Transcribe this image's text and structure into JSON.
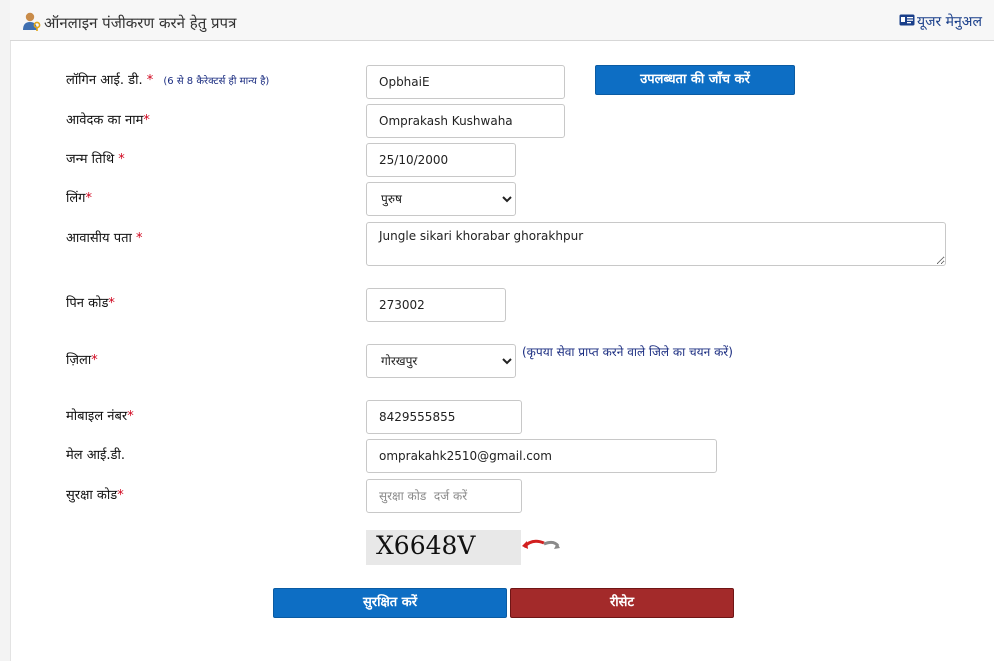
{
  "header": {
    "title": "ऑनलाइन पंजीकरण करने हेतु प्रपत्र",
    "title_icon": "user-key-icon",
    "user_manual": "यूजर मेनुअल",
    "user_manual_icon": "id-card-icon"
  },
  "form": {
    "login_id": {
      "label": "लॉगिन आई. डी.",
      "required": "*",
      "note": "(6 से 8 कैरेक्टर्स ही मान्य है)",
      "value": "OpbhaiE"
    },
    "check_button": "उपलब्धता की जाँच करें",
    "applicant_name": {
      "label": "आवेदक का नाम",
      "required": "*",
      "value": "Omprakash Kushwaha"
    },
    "dob": {
      "label": "जन्म तिथि",
      "required": "*",
      "value": "25/10/2000"
    },
    "gender": {
      "label": "लिंग",
      "required": "*",
      "value": "पुरुष"
    },
    "address": {
      "label": "आवासीय पता",
      "required": "*",
      "value": "Jungle sikari khorabar ghorakhpur"
    },
    "pin": {
      "label": "पिन कोड",
      "required": "*",
      "value": "273002"
    },
    "district": {
      "label": "ज़िला",
      "required": "*",
      "value": "गोरखपुर",
      "hint": "(कृपया सेवा प्राप्त करने वाले जिले का चयन करें)"
    },
    "mobile": {
      "label": "मोबाइल नंबर",
      "required": "*",
      "value": "8429555855"
    },
    "email": {
      "label": "मेल आई.डी.",
      "value": "omprakahk2510@gmail.com"
    },
    "security_code": {
      "label": "सुरक्षा कोड",
      "required": "*",
      "placeholder": "सुरक्षा कोड  दर्ज करें"
    },
    "captcha": {
      "text": "X6648V",
      "refresh_icon": "refresh-arrow-icon"
    }
  },
  "actions": {
    "save": "सुरक्षित करें",
    "reset": "रीसेट"
  },
  "colors": {
    "primary_button": "#0d6ec4",
    "reset_button": "#a32a2a",
    "required_mark": "#d0021b",
    "hint_text": "#1a2c80"
  }
}
